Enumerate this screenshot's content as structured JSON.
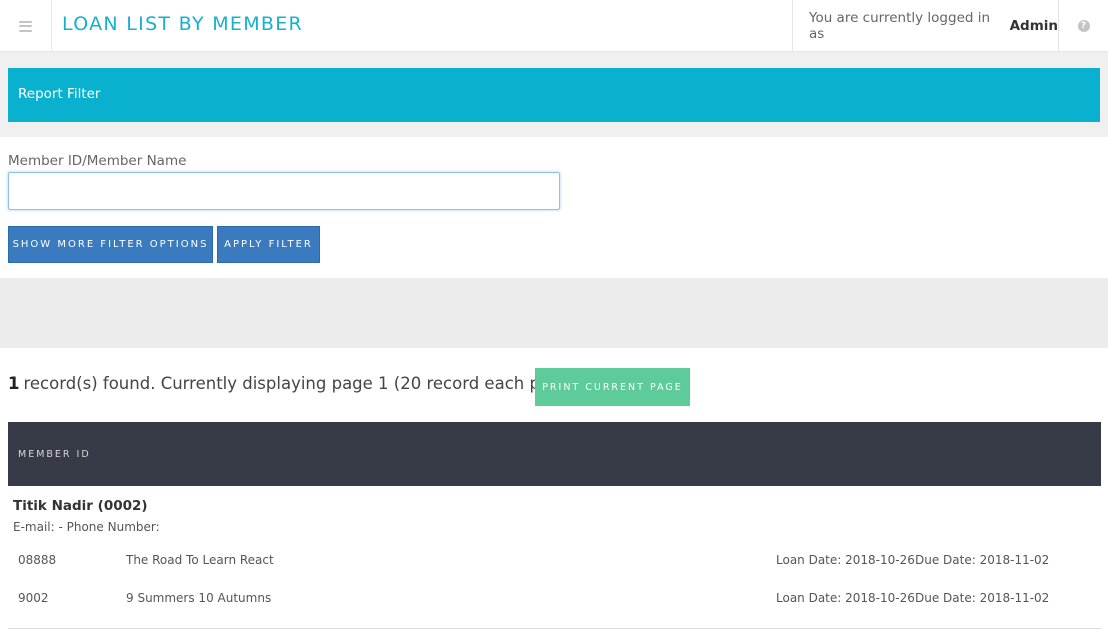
{
  "header": {
    "title": "LOAN LIST BY MEMBER",
    "login_prefix": "You are currently logged in as",
    "login_user": "Admin"
  },
  "filter": {
    "heading": "Report Filter",
    "member_field_label": "Member ID/Member Name",
    "member_field_value": "",
    "member_field_placeholder": "",
    "show_more_label": "SHOW MORE FILTER OPTIONS",
    "apply_label": "APPLY FILTER"
  },
  "results": {
    "count": "1",
    "summary": "record(s) found. Currently displaying page 1 (20 record each page)",
    "print_label": "PRINT CURRENT PAGE",
    "column_header": "MEMBER ID",
    "member": {
      "name": "Titik Nadir (0002)",
      "contact": "E-mail: - Phone Number:",
      "loans": [
        {
          "code": "08888",
          "title": "The Road To Learn React",
          "loan_date": "Loan Date: 2018-10-26",
          "due_date": "Due Date: 2018-11-02"
        },
        {
          "code": "9002",
          "title": "9 Summers 10 Autumns",
          "loan_date": "Loan Date: 2018-10-26",
          "due_date": "Due Date: 2018-11-02"
        }
      ]
    }
  },
  "icons": {
    "menu": "hamburger-menu-icon",
    "help": "question-circle-icon"
  },
  "colors": {
    "accent": "#09b1cf",
    "primary_button": "#3a7bbf",
    "print_button": "#5dcb9a",
    "table_header": "#363b47"
  }
}
